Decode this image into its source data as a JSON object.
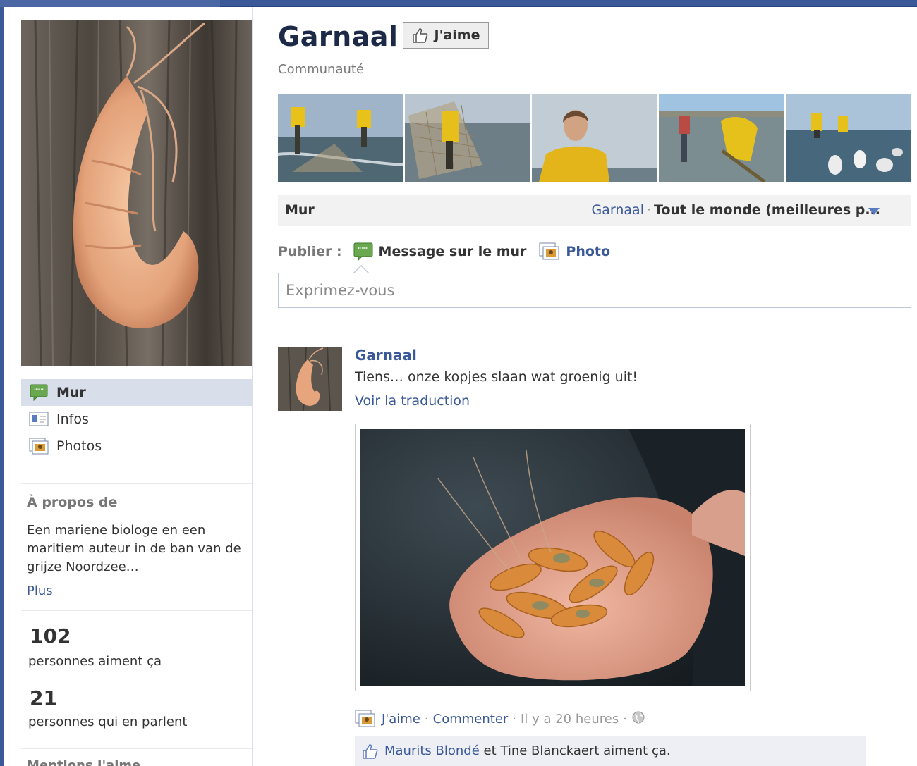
{
  "page": {
    "name": "Garnaal",
    "category": "Communauté",
    "like_button": "J'aime"
  },
  "sidebar": {
    "nav": [
      {
        "label": "Mur",
        "icon": "wall-icon",
        "active": true
      },
      {
        "label": "Infos",
        "icon": "info-icon",
        "active": false
      },
      {
        "label": "Photos",
        "icon": "photos-icon",
        "active": false
      }
    ],
    "about": {
      "heading": "À propos de",
      "text": "Een mariene biologe en een maritiem auteur in de ban van de grijze Noordzee…",
      "more": "Plus"
    },
    "stats": {
      "likes_count": "102",
      "likes_label": "personnes aiment ça",
      "talking_count": "21",
      "talking_label": "personnes qui en parlent"
    },
    "mentions_heading": "Mentions J'aime"
  },
  "wall": {
    "label": "Mur",
    "filter_page": "Garnaal",
    "filter_sep": "·",
    "filter_selected": "Tout le monde (meilleures p..."
  },
  "publisher": {
    "label": "Publier :",
    "options": [
      {
        "label": "Message sur le mur",
        "icon": "wall-post-icon"
      },
      {
        "label": "Photo",
        "icon": "photo-icon"
      }
    ],
    "placeholder": "Exprimez-vous"
  },
  "post": {
    "author": "Garnaal",
    "text": "Tiens… onze kopjes slaan wat groenig uit!",
    "translate": "Voir la traduction",
    "actions": {
      "like": "J'aime",
      "dot": "·",
      "comment": "Commenter",
      "time": "Il y a 20 heures"
    },
    "likes": {
      "person1": "Maurits Blondé",
      "connector": " et ",
      "person2": "Tine Blanckaert",
      "suffix": " aiment ça."
    }
  },
  "colors": {
    "brand_blue": "#3b5998",
    "nav_active_bg": "#d8dfea",
    "likes_bg": "#edeff4"
  }
}
